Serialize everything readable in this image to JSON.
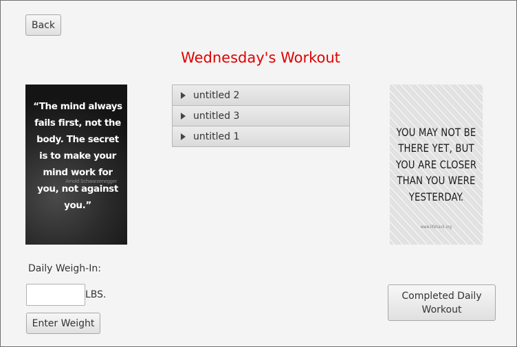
{
  "header": {
    "back_label": "Back",
    "title": "Wednesday's Workout"
  },
  "quotes": {
    "left": {
      "text": "“The mind always fails first, not the body. The secret is to make your mind work for you, not against you.”",
      "attribution": "Arnold Schwarzenegger"
    },
    "right": {
      "text": "YOU MAY NOT BE THERE YET, BUT YOU ARE CLOSER THAN YOU WERE YESTERDAY.",
      "attribution": "www.lifehack.org"
    }
  },
  "accordion": {
    "items": [
      {
        "label": "untitled 2"
      },
      {
        "label": "untitled 3"
      },
      {
        "label": "untitled 1"
      }
    ]
  },
  "weigh_in": {
    "label": "Daily Weigh-In:",
    "value": "",
    "unit": "LBS.",
    "enter_label": "Enter Weight"
  },
  "completed_label": "Completed Daily Workout"
}
